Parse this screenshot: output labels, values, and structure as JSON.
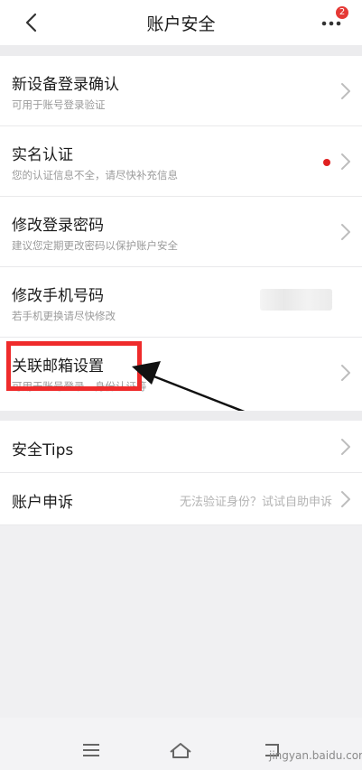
{
  "header": {
    "title": "账户安全",
    "badge_count": "2"
  },
  "items": [
    {
      "label": "新设备登录确认",
      "sub": "可用于账号登录验证"
    },
    {
      "label": "实名认证",
      "sub": "您的认证信息不全，请尽快补充信息"
    },
    {
      "label": "修改登录密码",
      "sub": "建议您定期更改密码以保护账户安全"
    },
    {
      "label": "修改手机号码",
      "sub": "若手机更换请尽快修改"
    },
    {
      "label": "关联邮箱设置",
      "sub": "可用于账号登录、身份认证等"
    }
  ],
  "extra": [
    {
      "label": "安全Tips",
      "hint": ""
    },
    {
      "label": "账户申诉",
      "hint": "无法验证身份？试试自助申诉"
    }
  ],
  "watermark": "jingyan.baidu.com",
  "colors": {
    "badge": "#e53935",
    "highlight": "#ef2b2b",
    "arrow": "#111111"
  },
  "icons": [
    "back-icon",
    "more-icon",
    "chevron-right-icon",
    "menu-icon",
    "home-icon",
    "back-nav-icon"
  ]
}
